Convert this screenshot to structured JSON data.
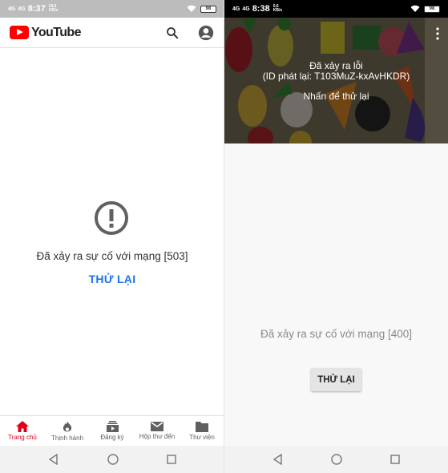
{
  "left": {
    "status": {
      "network": "4G",
      "network2": "4G",
      "time": "8:37",
      "speed": "24,3 KB/s",
      "battery": "98"
    },
    "appbar": {
      "brand": "YouTube"
    },
    "error": {
      "message": "Đã xảy ra sự cố với mạng [503]",
      "retry": "THỬ LẠI"
    },
    "nav": [
      {
        "label": "Trang chủ",
        "icon": "home-icon",
        "active": true
      },
      {
        "label": "Thịnh hành",
        "icon": "trending-icon",
        "active": false
      },
      {
        "label": "Đăng ký",
        "icon": "subscriptions-icon",
        "active": false
      },
      {
        "label": "Hộp thư đến",
        "icon": "inbox-icon",
        "active": false
      },
      {
        "label": "Thư viện",
        "icon": "library-icon",
        "active": false
      }
    ]
  },
  "right": {
    "status": {
      "network": "4G",
      "network2": "4G",
      "time": "8:38",
      "speed": "0,6 KB/s",
      "battery": "98"
    },
    "video": {
      "error_title": "Đã xảy ra lỗi",
      "playback_id": "(ID phát lại: T103MuZ-kxAvHKDR)",
      "tap_to_retry": "Nhấn để thử lại"
    },
    "error": {
      "message": "Đã xảy ra sự cố với mạng [400]",
      "retry": "THỬ LẠI"
    }
  },
  "colors": {
    "brand_red": "#ff0000",
    "link_blue": "#1a73e8",
    "active_nav": "#e0001b"
  }
}
